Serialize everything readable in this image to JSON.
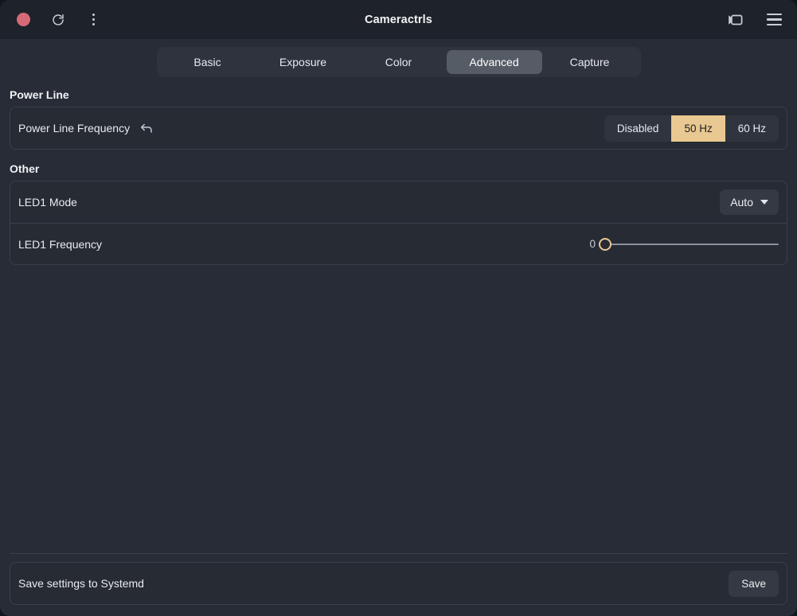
{
  "window": {
    "title": "Cameractrls",
    "titlebar": {
      "record_icon": "record-dot-icon",
      "refresh_icon": "refresh-icon",
      "menu_icon": "three-dots-vertical-icon",
      "camera_icon": "video-camera-icon",
      "hamburger_icon": "hamburger-menu-icon"
    }
  },
  "tabs": [
    {
      "label": "Basic",
      "active": false
    },
    {
      "label": "Exposure",
      "active": false
    },
    {
      "label": "Color",
      "active": false
    },
    {
      "label": "Advanced",
      "active": true
    },
    {
      "label": "Capture",
      "active": false
    }
  ],
  "sections": [
    {
      "title": "Power Line",
      "rows": [
        {
          "label": "Power Line Frequency",
          "reset_icon": "undo-arrow-icon",
          "control": "segmented",
          "options": [
            "Disabled",
            "50 Hz",
            "60 Hz"
          ],
          "selected": "50 Hz"
        }
      ]
    },
    {
      "title": "Other",
      "rows": [
        {
          "label": "LED1 Mode",
          "control": "dropdown",
          "value": "Auto",
          "caret_icon": "chevron-down-icon"
        },
        {
          "label": "LED1 Frequency",
          "control": "slider",
          "value": "0",
          "min": 0,
          "max": 255,
          "percent": 0
        }
      ]
    }
  ],
  "footer": {
    "label": "Save settings to Systemd",
    "save_label": "Save"
  },
  "colors": {
    "accent": "#e9c891",
    "record": "#d66a78",
    "window_bg": "#272c36",
    "header_bg": "#1e222a",
    "card_bg": "#262b34",
    "border": "#3a3f4a"
  }
}
